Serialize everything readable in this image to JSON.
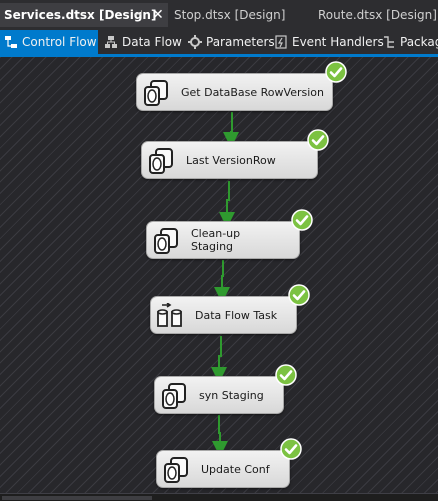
{
  "doc_tabs": [
    {
      "label": "Services.dtsx [Design]",
      "active": true
    },
    {
      "label": "Stop.dtsx [Design]",
      "active": false
    },
    {
      "label": "Route.dtsx [Design]",
      "active": false
    }
  ],
  "doc_tab_glyphs": {
    "pin": "⊣",
    "close": "✕"
  },
  "designer_tabs": [
    {
      "label": "Control Flow",
      "icon": "control-flow-icon",
      "active": true
    },
    {
      "label": "Data Flow",
      "icon": "data-flow-icon",
      "active": false
    },
    {
      "label": "Parameters",
      "icon": "parameters-icon",
      "active": false
    },
    {
      "label": "Event Handlers",
      "icon": "event-handlers-icon",
      "active": false
    },
    {
      "label": "Packag",
      "icon": "package-explorer-icon",
      "active": false
    }
  ],
  "tasks": [
    {
      "label": "Get DataBase RowVersion",
      "icon": "execute-sql-icon",
      "status": "success"
    },
    {
      "label": "Last VersionRow",
      "icon": "execute-sql-icon",
      "status": "success"
    },
    {
      "label": "Clean-up\nStaging",
      "icon": "execute-sql-icon",
      "status": "success"
    },
    {
      "label": "Data Flow Task",
      "icon": "data-flow-task-icon",
      "status": "success"
    },
    {
      "label": "syn Staging",
      "icon": "execute-sql-icon",
      "status": "success"
    },
    {
      "label": "Update Conf",
      "icon": "execute-sql-icon",
      "status": "success"
    }
  ],
  "colors": {
    "accent": "#007acc",
    "success": "#7cc242",
    "connector": "#2f9a2f"
  }
}
